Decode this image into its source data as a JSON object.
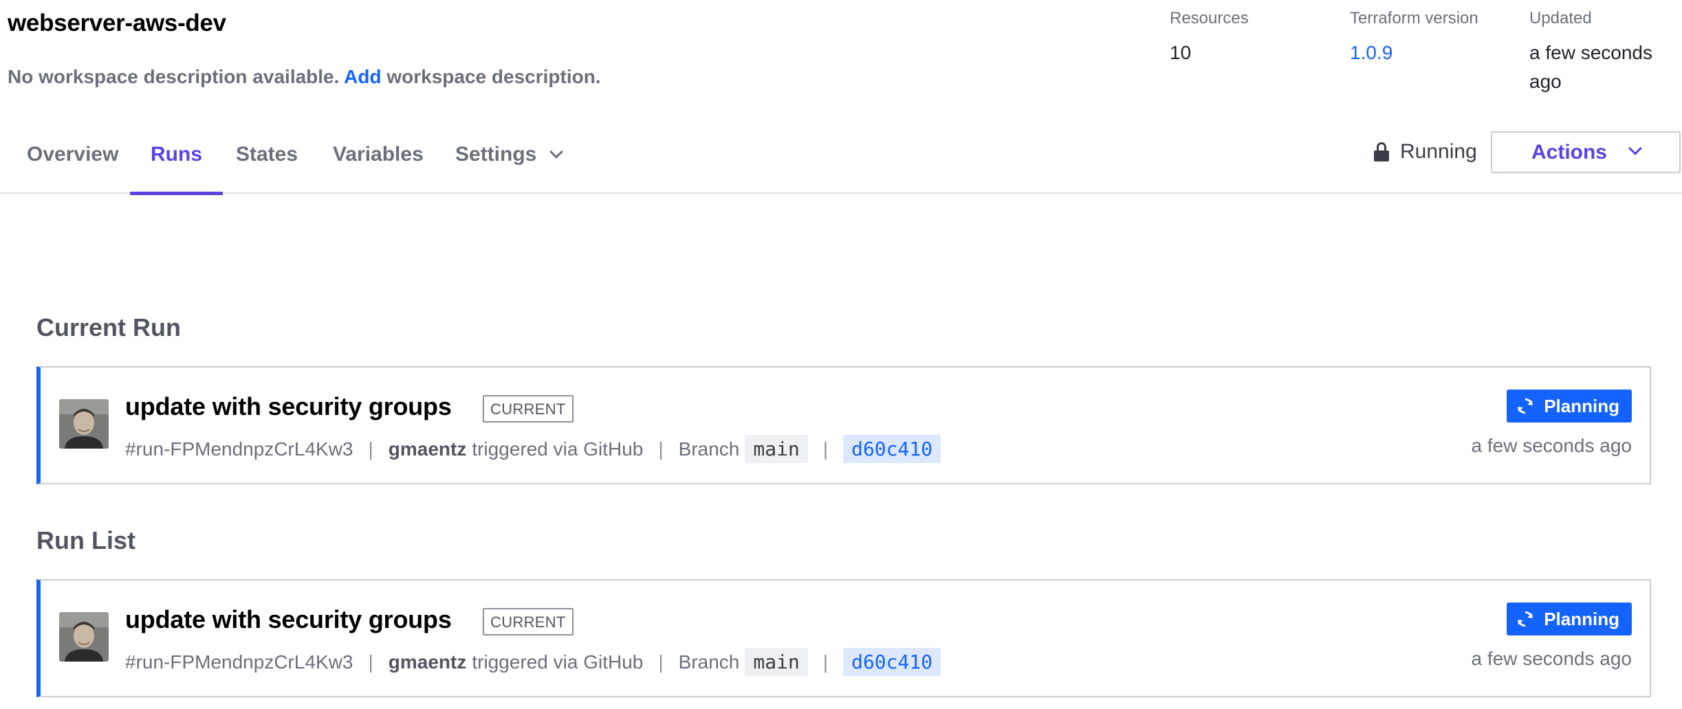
{
  "workspace": {
    "title": "webserver-aws-dev",
    "description_prefix": "No workspace description available.",
    "description_link": "Add",
    "description_suffix": "workspace description."
  },
  "meta": {
    "resources_label": "Resources",
    "resources_value": "10",
    "tf_version_label": "Terraform version",
    "tf_version_value": "1.0.9",
    "updated_label": "Updated",
    "updated_value": "a few seconds ago"
  },
  "tabs": [
    {
      "label": "Overview"
    },
    {
      "label": "Runs",
      "active": true
    },
    {
      "label": "States"
    },
    {
      "label": "Variables"
    },
    {
      "label": "Settings"
    }
  ],
  "status": {
    "label": "Running",
    "icon": "lock-icon"
  },
  "actions": {
    "label": "Actions"
  },
  "current_run": {
    "heading": "Current Run",
    "run": {
      "title": "update with security groups",
      "badge": "CURRENT",
      "run_id": "#run-FPMendnpzCrL4Kw3",
      "user": "gmaentz",
      "trigger": "triggered via GitHub",
      "branch_label": "Branch",
      "branch": "main",
      "commit": "d60c410",
      "status": "Planning",
      "time": "a few seconds ago"
    }
  },
  "run_list": {
    "heading": "Run List",
    "runs": [
      {
        "title": "update with security groups",
        "badge": "CURRENT",
        "run_id": "#run-FPMendnpzCrL4Kw3",
        "user": "gmaentz",
        "trigger": "triggered via GitHub",
        "branch_label": "Branch",
        "branch": "main",
        "commit": "d60c410",
        "status": "Planning",
        "time": "a few seconds ago"
      }
    ]
  },
  "colors": {
    "accent": "#5a43e0",
    "link": "#1563ff",
    "planning": "#1563ff"
  }
}
